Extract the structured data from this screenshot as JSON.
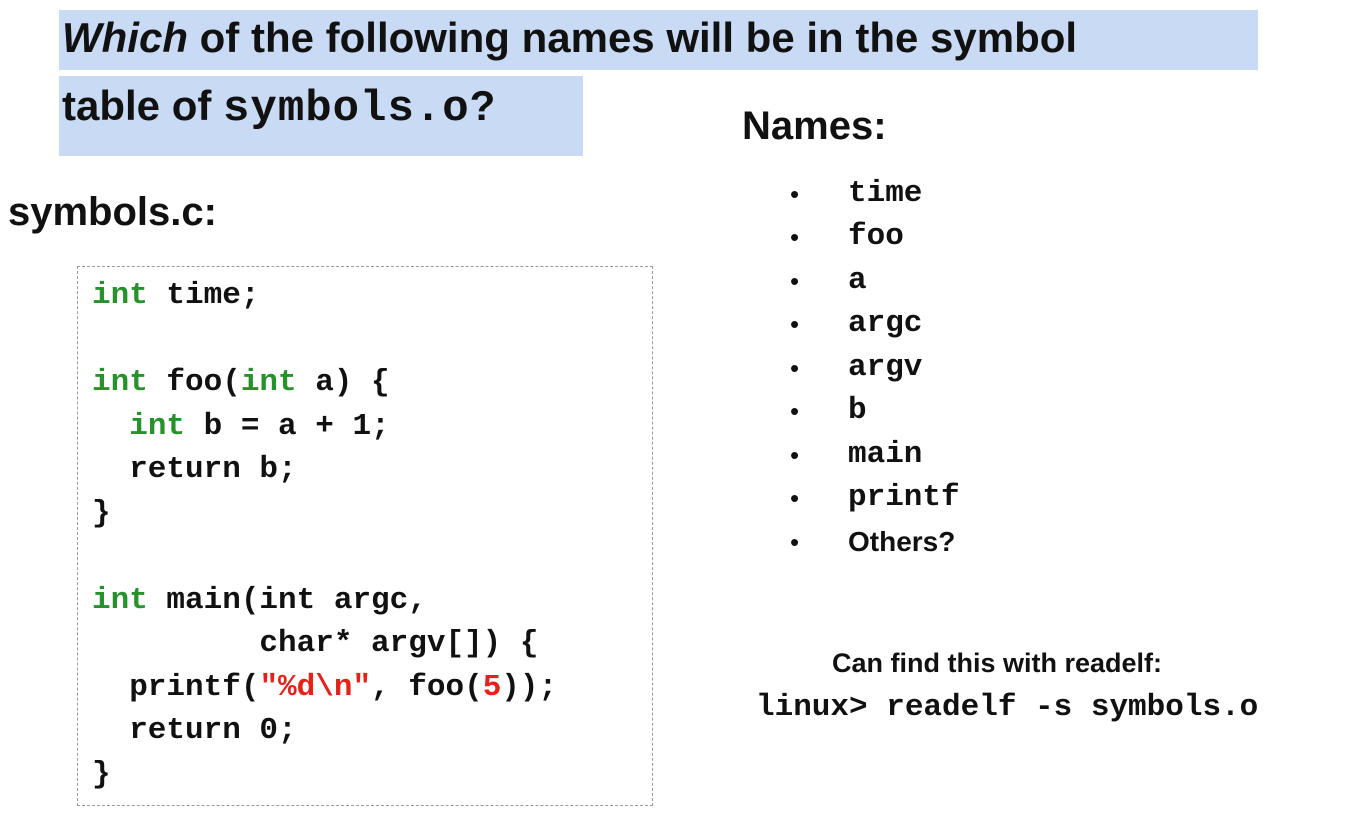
{
  "title": {
    "line1_italic": "Which",
    "line1_rest": " of the following names will be in the symbol",
    "line2_prefix": "table of ",
    "line2_code": "symbols.o",
    "line2_suffix": "?"
  },
  "file_heading": "symbols.c:",
  "names_heading": "Names:",
  "code": {
    "l1": {
      "kw": "int",
      "rest": " time;"
    },
    "l3": {
      "kw1": "int",
      "mid": " foo(",
      "kw2": "int",
      "rest": " a) {"
    },
    "l4": {
      "indent": "  ",
      "kw": "int",
      "rest": " b = a + 1;"
    },
    "l5": "  return b;",
    "l6": "}",
    "l8": {
      "kw": "int",
      "rest": " main(int argc,"
    },
    "l9": "         char* argv[]) {",
    "l10": {
      "pre": "  printf(",
      "str": "\"%d\\n\"",
      "mid": ", foo(",
      "num": "5",
      "post": "));"
    },
    "l11": "  return 0;",
    "l12": "}"
  },
  "names": [
    {
      "label": "time",
      "style": "mono"
    },
    {
      "label": "foo",
      "style": "mono"
    },
    {
      "label": "a",
      "style": "mono"
    },
    {
      "label": "argc",
      "style": "mono"
    },
    {
      "label": "argv",
      "style": "mono"
    },
    {
      "label": "b",
      "style": "mono"
    },
    {
      "label": "main",
      "style": "mono"
    },
    {
      "label": "printf",
      "style": "mono"
    },
    {
      "label": "Others?",
      "style": "sans"
    }
  ],
  "bullet": "•",
  "readelf": {
    "caption": "Can find this with readelf:",
    "command": "linux> readelf -s symbols.o"
  },
  "colors": {
    "title_highlight": "#c9daf5",
    "keyword": "#27912b",
    "literal": "#e2231a"
  }
}
